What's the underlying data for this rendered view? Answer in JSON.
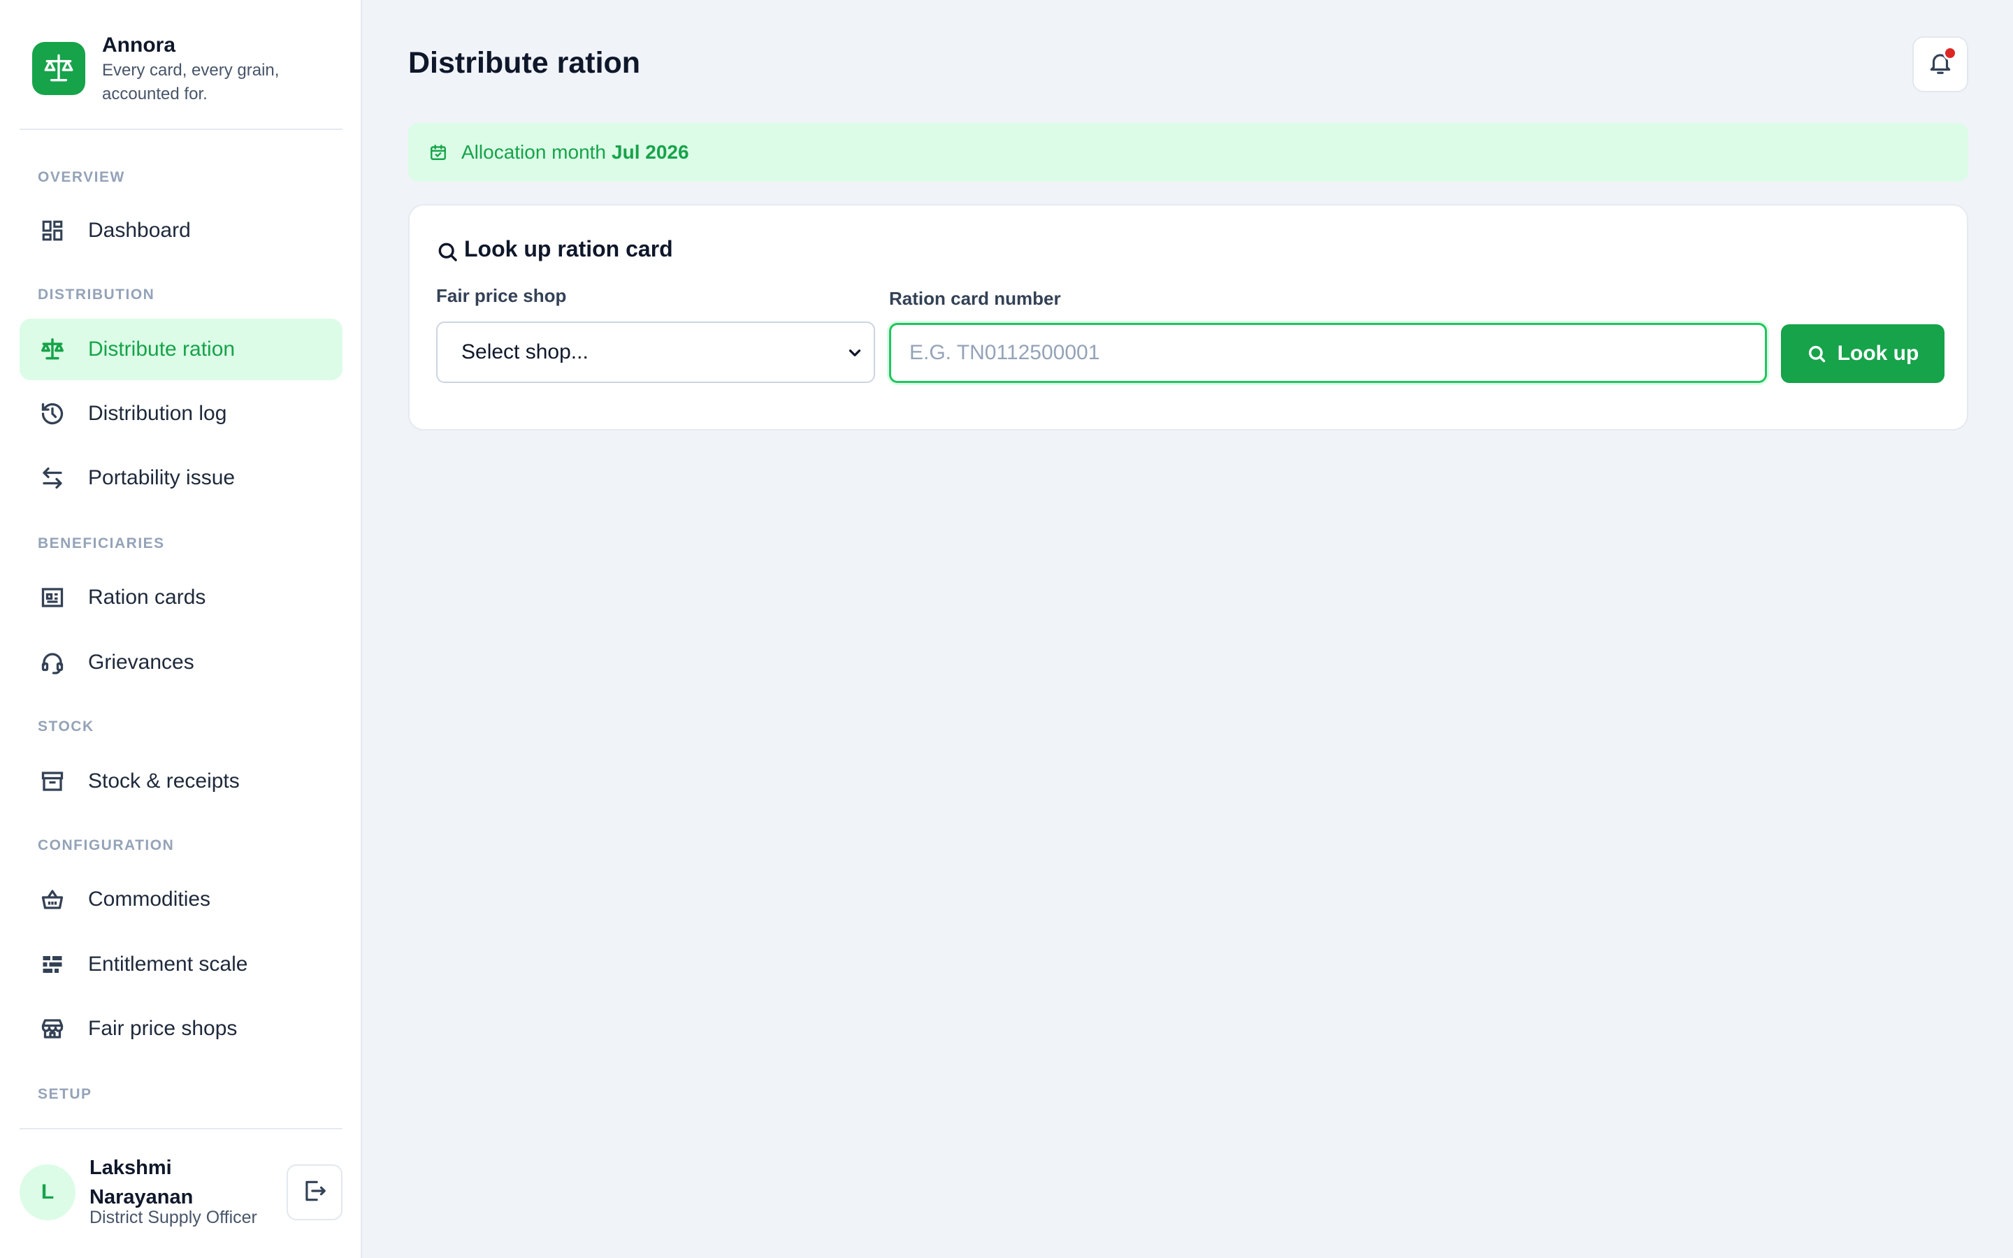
{
  "brand": {
    "name": "Annora",
    "tagline": "Every card, every grain, accounted for."
  },
  "sidebar": {
    "sections": [
      {
        "label": "OVERVIEW"
      },
      {
        "label": "DISTRIBUTION"
      },
      {
        "label": "BENEFICIARIES"
      },
      {
        "label": "STOCK"
      },
      {
        "label": "CONFIGURATION"
      },
      {
        "label": "SETUP"
      }
    ],
    "items": [
      {
        "label": "Dashboard",
        "icon": "dashboard-icon"
      },
      {
        "label": "Distribute ration",
        "icon": "scale-icon",
        "active": true
      },
      {
        "label": "Distribution log",
        "icon": "history-icon"
      },
      {
        "label": "Portability issue",
        "icon": "swap-icon"
      },
      {
        "label": "Ration cards",
        "icon": "card-list-icon"
      },
      {
        "label": "Grievances",
        "icon": "headset-icon"
      },
      {
        "label": "Stock & receipts",
        "icon": "archive-icon"
      },
      {
        "label": "Commodities",
        "icon": "basket-icon"
      },
      {
        "label": "Entitlement scale",
        "icon": "list-bars-icon"
      },
      {
        "label": "Fair price shops",
        "icon": "store-icon"
      }
    ]
  },
  "user": {
    "initial": "L",
    "name": "Lakshmi Narayanan",
    "role": "District Supply Officer"
  },
  "header": {
    "title": "Distribute ration"
  },
  "allocation": {
    "label": "Allocation month",
    "value": "Jul 2026"
  },
  "lookup": {
    "title": "Look up ration card",
    "shop_label": "Fair price shop",
    "shop_value": "Select shop...",
    "card_label": "Ration card number",
    "card_placeholder": "E.G. TN0112500001",
    "button_label": "Look up"
  },
  "colors": {
    "accent": "#16a34a",
    "accent_light": "#dcfce7",
    "alert": "#dc2626"
  }
}
